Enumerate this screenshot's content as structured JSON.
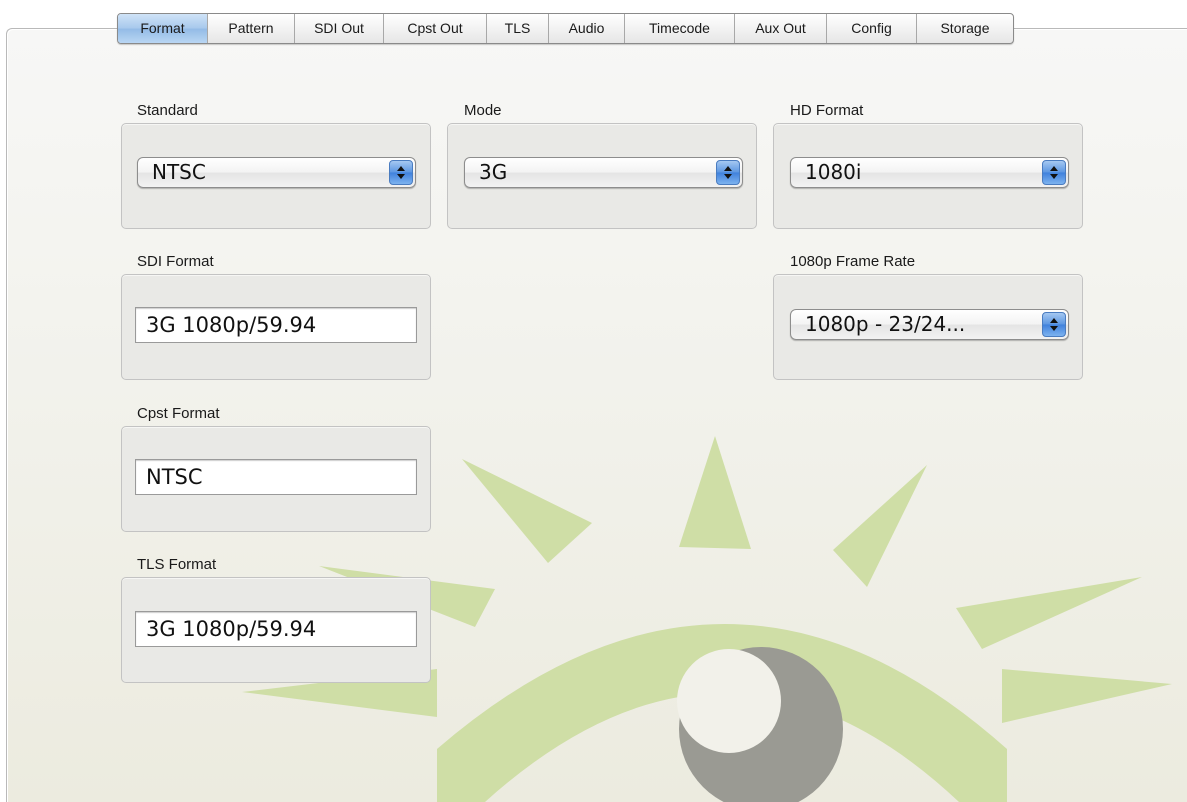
{
  "tabs": [
    "Format",
    "Pattern",
    "SDI Out",
    "Cpst Out",
    "TLS",
    "Audio",
    "Timecode",
    "Aux Out",
    "Config",
    "Storage"
  ],
  "active_tab": "Format",
  "standard": {
    "label": "Standard",
    "value": "NTSC"
  },
  "mode": {
    "label": "Mode",
    "value": "3G"
  },
  "hd_format": {
    "label": "HD Format",
    "value": "1080i"
  },
  "sdi_format": {
    "label": "SDI Format",
    "value": "3G 1080p/59.94"
  },
  "frame_rate_1080p": {
    "label": "1080p Frame Rate",
    "value": "1080p - 23/24..."
  },
  "cpst_format": {
    "label": "Cpst Format",
    "value": "NTSC"
  },
  "tls_format": {
    "label": "TLS Format",
    "value": "3G 1080p/59.94"
  },
  "colors": {
    "logo_green": "#cfdea6",
    "logo_gray": "#9a9a93",
    "tab_active": "#a7c8ec",
    "stepper_blue": "#3f80dc"
  },
  "icons": {
    "logo": "eye-sun-logo-icon",
    "popup_arrows": "up-down-stepper-icon"
  }
}
